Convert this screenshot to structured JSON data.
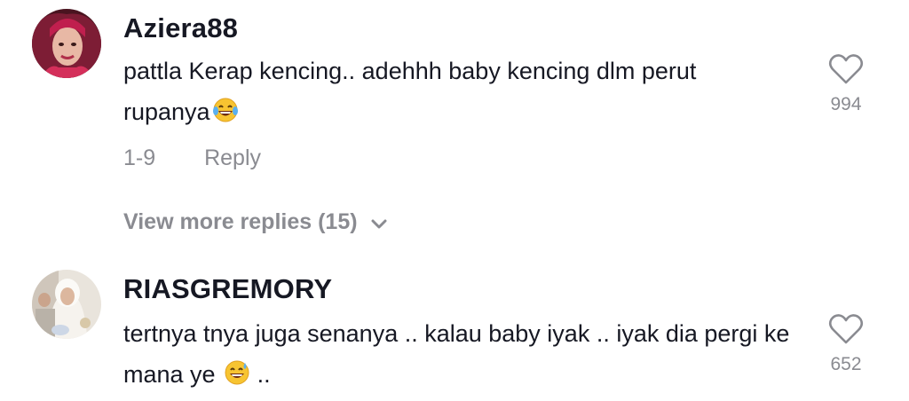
{
  "comments": [
    {
      "username": "Aziera88",
      "text": "pattla Kerap kencing.. adehhh baby kencing dlm perut rupanya",
      "emoji_icon": "rolling-laughing-emoji",
      "date": "1-9",
      "reply_label": "Reply",
      "likes": "994",
      "view_more": "View more replies (15)"
    },
    {
      "username": "RIASGREMORY",
      "text_before_emoji": "tertnya tnya juga senanya .. kalau baby iyak .. iyak dia pergi ke mana ye ",
      "emoji_icon": "grinning-sweat-emoji",
      "text_after_emoji": " ..",
      "likes": "652"
    }
  ],
  "colors": {
    "text": "#161823",
    "muted": "#8a8b91",
    "background": "#ffffff"
  },
  "icons": {
    "like": "heart-outline-icon",
    "expand": "chevron-down-icon"
  }
}
